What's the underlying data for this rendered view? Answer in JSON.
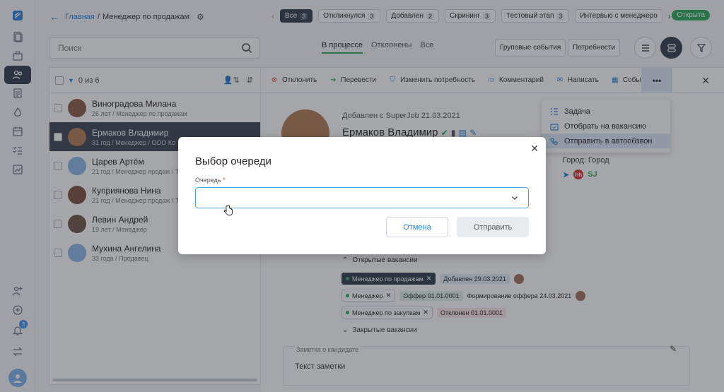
{
  "breadcrumb": {
    "home": "Главная",
    "separator": "/",
    "current": "Менеджер по продажам"
  },
  "stage_chips": [
    {
      "label": "Все",
      "count": "3",
      "active": true
    },
    {
      "label": "Откликнулся",
      "count": "3"
    },
    {
      "label": "Добавлен",
      "count": "2"
    },
    {
      "label": "Скрининг",
      "count": "3"
    },
    {
      "label": "Тестовый этап",
      "count": "3"
    },
    {
      "label": "Интервью с менеджеро",
      "count": ""
    }
  ],
  "vacancy_status": "Открыта",
  "search": {
    "placeholder": "Поиск"
  },
  "tabs": [
    "В процессе",
    "Отклонены",
    "Все"
  ],
  "top_buttons": {
    "group_events": "Груповые события",
    "needs": "Потребности"
  },
  "list": {
    "counter": "0 из 6",
    "candidates": [
      {
        "name": "Виноградова Милана",
        "sub": "26 лет / Менеджер по продажам",
        "avatar_color": "#8a5a45"
      },
      {
        "name": "Ермаков Владимир",
        "sub": "31 год / Менеджер / ООО Ко",
        "avatar_color": "#b07a54",
        "selected": true
      },
      {
        "name": "Царев Артём",
        "sub": "21 год / Менеджер продаж / Тк",
        "avatar_color": "#8ab8e6"
      },
      {
        "name": "Куприянова Нина",
        "sub": "21 год / Менеджер продаж / Т",
        "avatar_color": "#7a4f3a"
      },
      {
        "name": "Левин Андрей",
        "sub": "19 лет / Менеджер",
        "avatar_color": "#6e5444"
      },
      {
        "name": "Мухина Ангелина",
        "sub": "33 года / Продавец",
        "avatar_color": "#8ab8e6"
      }
    ]
  },
  "actions": {
    "reject": "Отклонить",
    "transfer": "Перевести",
    "change_need": "Изменить потребность",
    "comment": "Комментарий",
    "write": "Написать",
    "events": "События",
    "more": "•••"
  },
  "dropdown": {
    "task": "Задача",
    "select_vacancy": "Отобрать на вакансию",
    "autodial": "Отправить в автообзвон"
  },
  "profile": {
    "added": "Добавлен с SuperJob 21.03.2021",
    "name": "Ермаков Владимир",
    "city_label": "Город:",
    "city": "Город",
    "social_hh": "hh",
    "social_sj": "SJ"
  },
  "open_vacancies": {
    "title": "Открытые вакансии",
    "rows": [
      {
        "vacancy": "Менеджер по продажам",
        "stage": "Добавлен",
        "stage_date": "29.03.2021",
        "extra": ""
      },
      {
        "vacancy": "Менеджер",
        "stage": "Оффер",
        "stage_date": "01.01.0001",
        "extra": "Формирование оффера 24.03.2021"
      },
      {
        "vacancy": "Менеджер по закупкам",
        "stage": "Отклонен",
        "stage_date": "01.01.0001",
        "extra": ""
      }
    ]
  },
  "closed_vacancies": {
    "title": "Закрытые вакансии"
  },
  "note": {
    "label": "Заметка о кандидате",
    "text": "Текст заметки"
  },
  "modal": {
    "title": "Выбор очереди",
    "field_label": "Очередь",
    "required_mark": "*",
    "cancel": "Отмена",
    "submit": "Отправить"
  },
  "notifications_count": "3",
  "colors": {
    "accent": "#2a84d8",
    "success": "#2eaa5c",
    "dark": "#2f3b4a",
    "danger": "#e0443c"
  }
}
